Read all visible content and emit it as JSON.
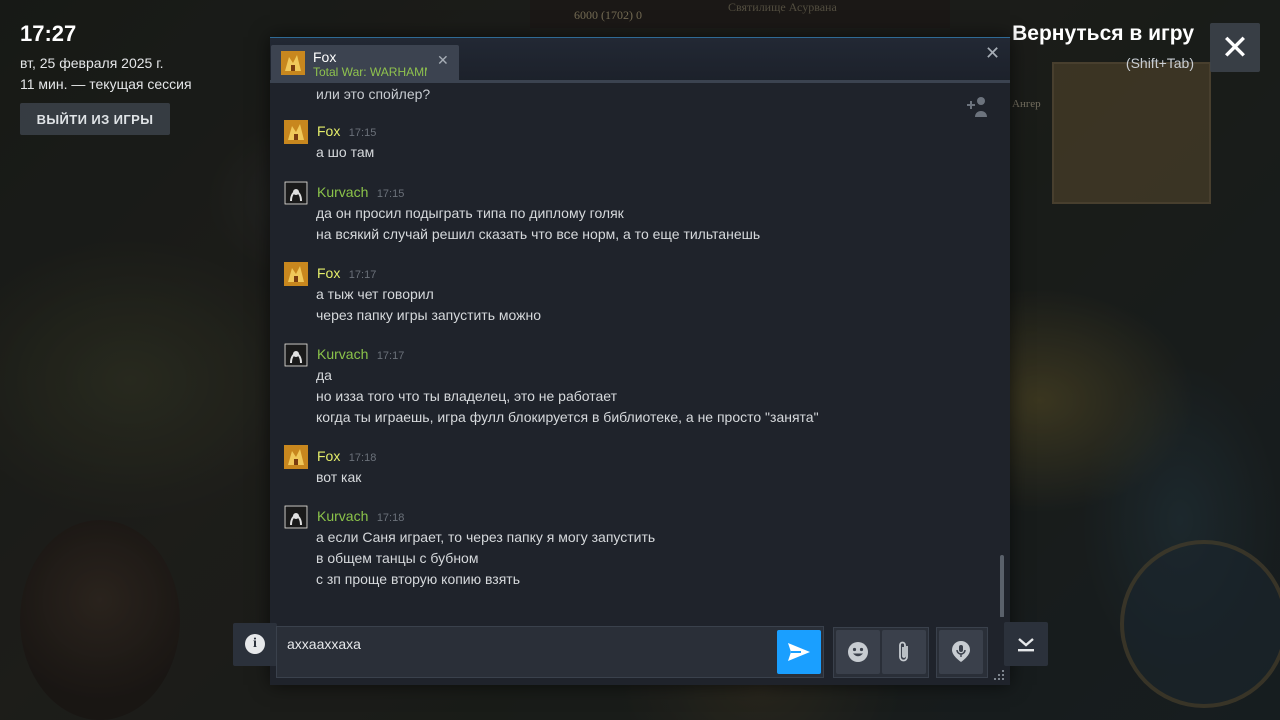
{
  "overlay": {
    "clock": "17:27",
    "date": "вт, 25 февраля 2025 г.",
    "session": "11 мин. — текущая сессия",
    "exit_label": "ВЫЙТИ ИЗ ИГРЫ",
    "return_title": "Вернуться в игру",
    "return_hint": "(Shift+Tab)"
  },
  "game_hud": {
    "resources": "6000 (1702)  0",
    "location": "Святилище Асурвана",
    "minimap_label": "Ангер"
  },
  "chat": {
    "tab": {
      "name": "Fox",
      "game": "Total War: WARHAMMER"
    },
    "top_line": "или это спойлер?",
    "groups": [
      {
        "author": "Fox",
        "time": "17:15",
        "lines": [
          "а шо там"
        ]
      },
      {
        "author": "Kurvach",
        "time": "17:15",
        "lines": [
          "да он просил подыграть типа по диплому голяк",
          "на всякий случай решил сказать что все норм, а то еще тильтанешь"
        ]
      },
      {
        "author": "Fox",
        "time": "17:17",
        "lines": [
          "а тыж чет говорил",
          "через папку игры запустить можно"
        ]
      },
      {
        "author": "Kurvach",
        "time": "17:17",
        "lines": [
          "да",
          "но изза того что ты владелец, это не работает",
          "когда ты играешь, игра фулл блокируется в библиотеке, а не просто \"занята\""
        ]
      },
      {
        "author": "Fox",
        "time": "17:18",
        "lines": [
          "вот как"
        ]
      },
      {
        "author": "Kurvach",
        "time": "17:18",
        "lines": [
          "а если Саня играет, то через папку я могу запустить",
          "в общем танцы с бубном",
          "с зп проще вторую копию взять"
        ]
      }
    ],
    "input_value": "ахxaaxxaxa"
  },
  "colors": {
    "accent": "#1a9fff",
    "fox_name": "#e4ed6a",
    "kurvach_name": "#8bc34a",
    "game_text": "#8fc24e"
  },
  "icons": [
    "close-icon",
    "info-icon",
    "send-icon",
    "emoji-icon",
    "attach-icon",
    "voice-icon",
    "collapse-icon",
    "add-friend-icon",
    "resize-grip-icon"
  ]
}
